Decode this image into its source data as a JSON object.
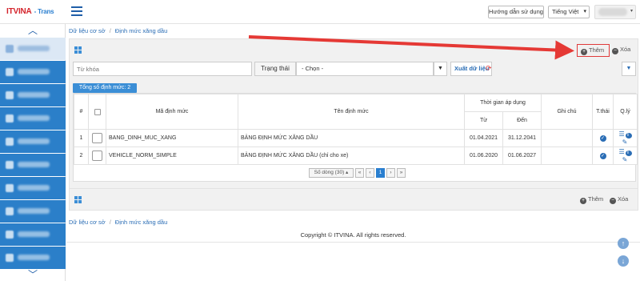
{
  "header": {
    "logo_brand": "ITVINA",
    "logo_product": "- Trans",
    "guide_button": "Hướng dẫn sử dụng",
    "language": "Tiếng Việt"
  },
  "breadcrumb": {
    "root": "Dữ liệu cơ sở",
    "current": "Định mức xăng dầu"
  },
  "toolbar": {
    "add_label": "Thêm",
    "delete_label": "Xóa"
  },
  "filters": {
    "keyword_placeholder": "Từ khóa",
    "status_label": "Trạng thái",
    "status_value": "- Chọn -",
    "export_label": "Xuất dữ liệu"
  },
  "total_badge": "Tổng số định mức: 2",
  "table": {
    "headers": {
      "no": "#",
      "code": "Mã định mức",
      "name": "Tên định mức",
      "apply_time": "Thời gian áp dụng",
      "from": "Từ",
      "to": "Đến",
      "note": "Ghi chú",
      "status": "T.thái",
      "manage": "Q.lý"
    },
    "rows": [
      {
        "no": "1",
        "code": "BANG_DINH_MUC_XANG",
        "name": "BẢNG ĐỊNH MỨC XĂNG DẦU",
        "from": "01.04.2021",
        "to": "31.12.2041",
        "note": ""
      },
      {
        "no": "2",
        "code": "VEHICLE_NORM_SIMPLE",
        "name": "BẢNG ĐỊNH MỨC XĂNG DẦU (chỉ cho xe)",
        "from": "01.06.2020",
        "to": "01.06.2027",
        "note": ""
      }
    ]
  },
  "pager": {
    "rows_label": "Số dòng (30)",
    "first": "«",
    "prev": "‹",
    "page": "1",
    "next": "›",
    "last": "»"
  },
  "footer": {
    "copyright": "Copyright © ITVINA. All rights reserved."
  },
  "colors": {
    "accent": "#2a7fd0",
    "sidebar": "#2b7fc9",
    "highlight": "#e03a3a"
  }
}
